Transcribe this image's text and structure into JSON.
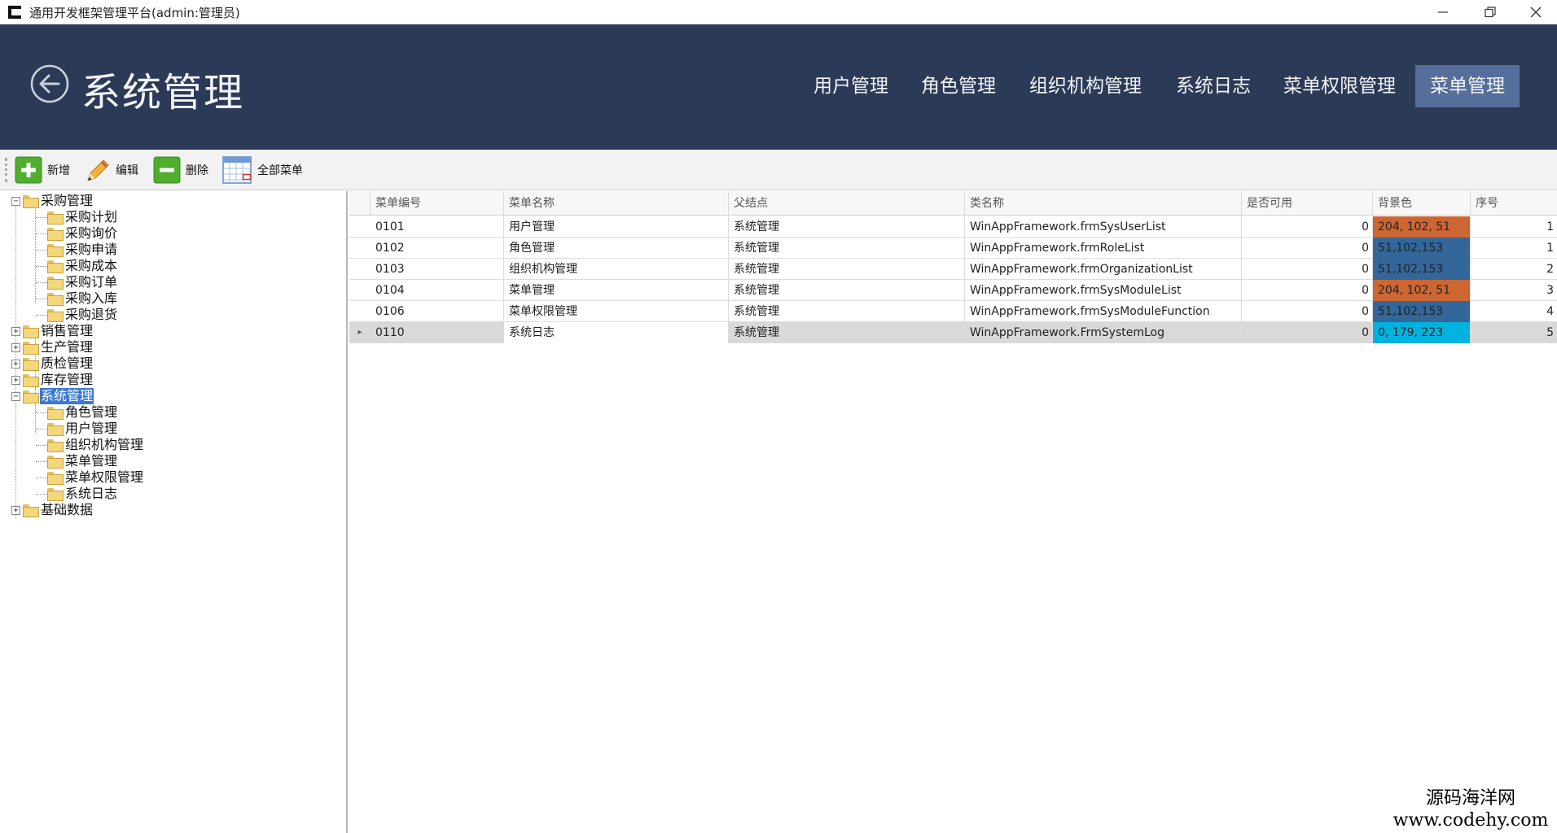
{
  "window": {
    "title": "通用开发框架管理平台(admin:管理员)",
    "controls": [
      "minimize-icon",
      "maximize-icon",
      "close-icon"
    ]
  },
  "header": {
    "title": "系统管理",
    "back_icon": "back-arrow-icon",
    "tabs": [
      {
        "label": "用户管理",
        "active": false
      },
      {
        "label": "角色管理",
        "active": false
      },
      {
        "label": "组织机构管理",
        "active": false
      },
      {
        "label": "系统日志",
        "active": false
      },
      {
        "label": "菜单权限管理",
        "active": false
      },
      {
        "label": "菜单管理",
        "active": true
      }
    ],
    "colors": {
      "background": "#2b3a56",
      "active_tab": "#566e9a"
    }
  },
  "toolbar": {
    "items": [
      {
        "label": "新增",
        "icon": "plus-icon"
      },
      {
        "label": "编辑",
        "icon": "pencil-icon"
      },
      {
        "label": "删除",
        "icon": "minus-icon"
      },
      {
        "label": "全部菜单",
        "icon": "calendar-grid-icon"
      }
    ]
  },
  "tree": {
    "nodes": [
      {
        "label": "采购管理",
        "level": 0,
        "expanded": true
      },
      {
        "label": "采购计划",
        "level": 1
      },
      {
        "label": "采购询价",
        "level": 1
      },
      {
        "label": "采购申请",
        "level": 1
      },
      {
        "label": "采购成本",
        "level": 1
      },
      {
        "label": "采购订单",
        "level": 1
      },
      {
        "label": "采购入库",
        "level": 1
      },
      {
        "label": "采购退货",
        "level": 1
      },
      {
        "label": "销售管理",
        "level": 0,
        "expanded": false
      },
      {
        "label": "生产管理",
        "level": 0,
        "expanded": false
      },
      {
        "label": "质检管理",
        "level": 0,
        "expanded": false
      },
      {
        "label": "库存管理",
        "level": 0,
        "expanded": false
      },
      {
        "label": "系统管理",
        "level": 0,
        "expanded": true,
        "selected": true
      },
      {
        "label": "角色管理",
        "level": 1
      },
      {
        "label": "用户管理",
        "level": 1
      },
      {
        "label": "组织机构管理",
        "level": 1
      },
      {
        "label": "菜单管理",
        "level": 1
      },
      {
        "label": "菜单权限管理",
        "level": 1
      },
      {
        "label": "系统日志",
        "level": 1
      },
      {
        "label": "基础数据",
        "level": 0,
        "expanded": false
      }
    ]
  },
  "grid": {
    "columns": [
      "菜单编号",
      "菜单名称",
      "父结点",
      "类名称",
      "是否可用",
      "背景色",
      "序号"
    ],
    "rows": [
      {
        "code": "0101",
        "name": "用户管理",
        "parent": "系统管理",
        "class": "WinAppFramework.frmSysUserList",
        "enabled": "0",
        "bg": "204, 102, 51",
        "bg_color": "#cc6633",
        "order": "1",
        "current": false
      },
      {
        "code": "0102",
        "name": "角色管理",
        "parent": "系统管理",
        "class": "WinAppFramework.frmRoleList",
        "enabled": "0",
        "bg": "51,102,153",
        "bg_color": "#336699",
        "order": "1",
        "current": false
      },
      {
        "code": "0103",
        "name": "组织机构管理",
        "parent": "系统管理",
        "class": "WinAppFramework.frmOrganizationList",
        "enabled": "0",
        "bg": "51,102,153",
        "bg_color": "#336699",
        "order": "2",
        "current": false
      },
      {
        "code": "0104",
        "name": "菜单管理",
        "parent": "系统管理",
        "class": "WinAppFramework.frmSysModuleList",
        "enabled": "0",
        "bg": "204, 102, 51",
        "bg_color": "#cc6633",
        "order": "3",
        "current": false
      },
      {
        "code": "0106",
        "name": "菜单权限管理",
        "parent": "系统管理",
        "class": "WinAppFramework.frmSysModuleFunction",
        "enabled": "0",
        "bg": "51,102,153",
        "bg_color": "#336699",
        "order": "4",
        "current": false
      },
      {
        "code": "0110",
        "name": "系统日志",
        "parent": "系统管理",
        "class": "WinAppFramework.FrmSystemLog",
        "enabled": "0",
        "bg": "0, 179, 223",
        "bg_color": "#00b3df",
        "order": "5",
        "current": true
      }
    ]
  },
  "watermark": {
    "line1": "源码海洋网",
    "line2": "www.codehy.com"
  }
}
